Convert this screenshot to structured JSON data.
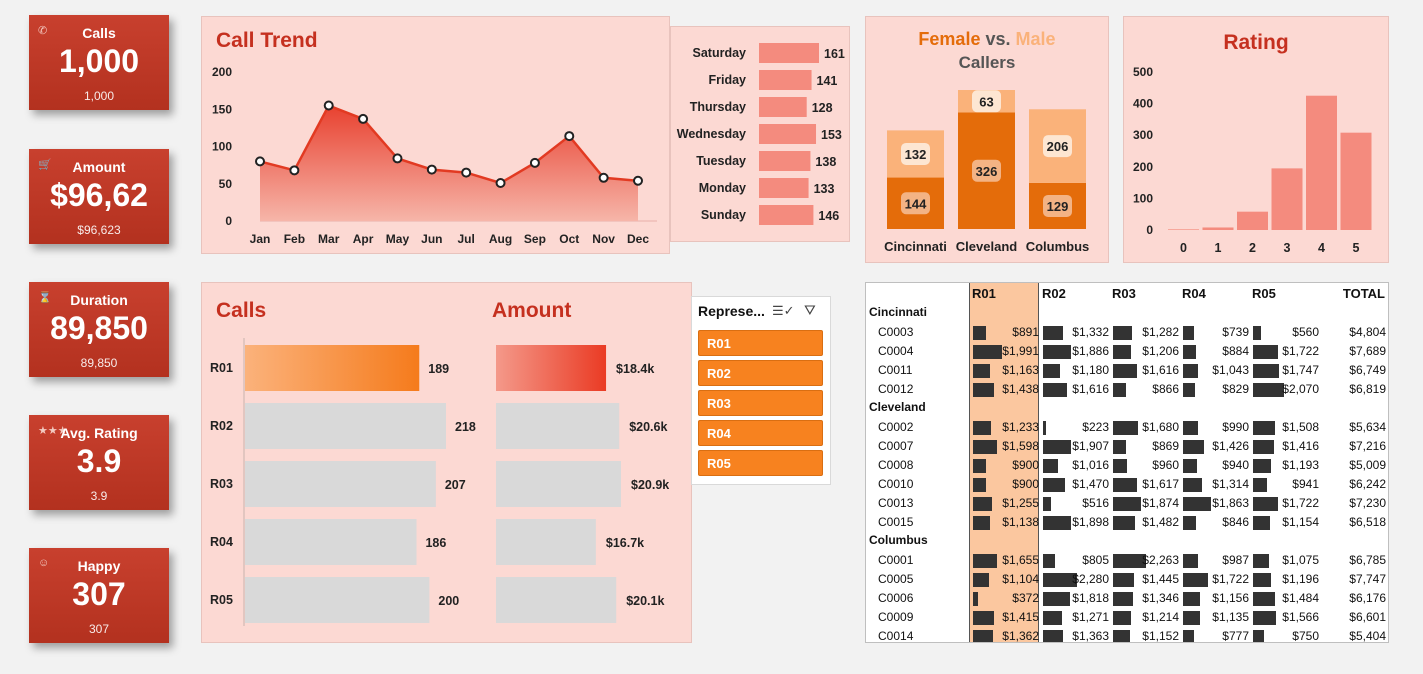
{
  "kpis": [
    {
      "icon": "phone-icon",
      "glyph": "✆",
      "title": "Calls",
      "value": "1,000",
      "sub": "1,000"
    },
    {
      "icon": "cart-icon",
      "glyph": "🛒",
      "title": "Amount",
      "value": "$96,62",
      "sub": "$96,623"
    },
    {
      "icon": "hourglass-icon",
      "glyph": "⌛",
      "title": "Duration",
      "value": "89,850",
      "sub": "89,850"
    },
    {
      "icon": "stars-icon",
      "glyph": "★★★",
      "title": "Avg. Rating",
      "value": "3.9",
      "sub": "3.9"
    },
    {
      "icon": "smiley-icon",
      "glyph": "☺",
      "title": "Happy",
      "value": "307",
      "sub": "307"
    }
  ],
  "call_trend": {
    "title": "Call Trend"
  },
  "weekday": {
    "labels": [
      "Saturday",
      "Friday",
      "Thursday",
      "Wednesday",
      "Tuesday",
      "Monday",
      "Sunday"
    ],
    "values": [
      161,
      141,
      128,
      153,
      138,
      133,
      146
    ]
  },
  "gender": {
    "female": "Female",
    "vs": "vs.",
    "male": "Male",
    "callers": "Callers",
    "color_female": "#e46c0a",
    "color_male": "#fab27a"
  },
  "rating": {
    "title": "Rating"
  },
  "reps": {
    "calls_title": "Calls",
    "amount_title": "Amount",
    "names": [
      "R01",
      "R02",
      "R03",
      "R04",
      "R05"
    ],
    "calls": [
      189,
      218,
      207,
      186,
      200
    ],
    "amount_labels": [
      "$18.4k",
      "$20.6k",
      "$20.9k",
      "$16.7k",
      "$20.1k"
    ]
  },
  "slicer": {
    "title": "Represe...",
    "items": [
      "R01",
      "R02",
      "R03",
      "R04",
      "R05"
    ],
    "multi_icon": "multi-select-icon",
    "clear_icon": "clear-filter-icon"
  },
  "pivot": {
    "headers": [
      "R01",
      "R02",
      "R03",
      "R04",
      "R05",
      "TOTAL"
    ],
    "groups": [
      {
        "city": "Cincinnati",
        "rows": [
          {
            "id": "C0003",
            "vals": [
              "$891",
              "$1,332",
              "$1,282",
              "$739",
              "$560",
              "$4,804"
            ]
          },
          {
            "id": "C0004",
            "vals": [
              "$1,991",
              "$1,886",
              "$1,206",
              "$884",
              "$1,722",
              "$7,689"
            ]
          },
          {
            "id": "C0011",
            "vals": [
              "$1,163",
              "$1,180",
              "$1,616",
              "$1,043",
              "$1,747",
              "$6,749"
            ]
          },
          {
            "id": "C0012",
            "vals": [
              "$1,438",
              "$1,616",
              "$866",
              "$829",
              "$2,070",
              "$6,819"
            ]
          }
        ]
      },
      {
        "city": "Cleveland",
        "rows": [
          {
            "id": "C0002",
            "vals": [
              "$1,233",
              "$223",
              "$1,680",
              "$990",
              "$1,508",
              "$5,634"
            ]
          },
          {
            "id": "C0007",
            "vals": [
              "$1,598",
              "$1,907",
              "$869",
              "$1,426",
              "$1,416",
              "$7,216"
            ]
          },
          {
            "id": "C0008",
            "vals": [
              "$900",
              "$1,016",
              "$960",
              "$940",
              "$1,193",
              "$5,009"
            ]
          },
          {
            "id": "C0010",
            "vals": [
              "$900",
              "$1,470",
              "$1,617",
              "$1,314",
              "$941",
              "$6,242"
            ]
          },
          {
            "id": "C0013",
            "vals": [
              "$1,255",
              "$516",
              "$1,874",
              "$1,863",
              "$1,722",
              "$7,230"
            ]
          },
          {
            "id": "C0015",
            "vals": [
              "$1,138",
              "$1,898",
              "$1,482",
              "$846",
              "$1,154",
              "$6,518"
            ]
          }
        ]
      },
      {
        "city": "Columbus",
        "rows": [
          {
            "id": "C0001",
            "vals": [
              "$1,655",
              "$805",
              "$2,263",
              "$987",
              "$1,075",
              "$6,785"
            ]
          },
          {
            "id": "C0005",
            "vals": [
              "$1,104",
              "$2,280",
              "$1,445",
              "$1,722",
              "$1,196",
              "$7,747"
            ]
          },
          {
            "id": "C0006",
            "vals": [
              "$372",
              "$1,818",
              "$1,346",
              "$1,156",
              "$1,484",
              "$6,176"
            ]
          },
          {
            "id": "C0009",
            "vals": [
              "$1,415",
              "$1,271",
              "$1,214",
              "$1,135",
              "$1,566",
              "$6,601"
            ]
          },
          {
            "id": "C0014",
            "vals": [
              "$1,362",
              "$1,363",
              "$1,152",
              "$777",
              "$750",
              "$5,404"
            ]
          }
        ]
      }
    ]
  },
  "chart_data": [
    {
      "type": "area",
      "title": "Call Trend",
      "categories": [
        "Jan",
        "Feb",
        "Mar",
        "Apr",
        "May",
        "Jun",
        "Jul",
        "Aug",
        "Sep",
        "Oct",
        "Nov",
        "Dec"
      ],
      "values": [
        80,
        68,
        155,
        137,
        84,
        69,
        65,
        51,
        78,
        114,
        58,
        54
      ],
      "ylim": [
        0,
        200
      ],
      "yticks": [
        "0",
        "50",
        "100",
        "150",
        "200"
      ]
    },
    {
      "type": "bar",
      "categories": [
        "Saturday",
        "Friday",
        "Thursday",
        "Wednesday",
        "Tuesday",
        "Monday",
        "Sunday"
      ],
      "values": [
        161,
        141,
        128,
        153,
        138,
        133,
        146
      ]
    },
    {
      "type": "bar",
      "title": "Female vs. Male Callers",
      "categories": [
        "Cincinnati",
        "Cleveland",
        "Columbus"
      ],
      "series": [
        {
          "name": "Female",
          "values": [
            144,
            326,
            129
          ]
        },
        {
          "name": "Male",
          "values": [
            132,
            63,
            206
          ]
        }
      ]
    },
    {
      "type": "bar",
      "title": "Rating",
      "categories": [
        "0",
        "1",
        "2",
        "3",
        "4",
        "5"
      ],
      "values": [
        2,
        8,
        58,
        195,
        425,
        308
      ],
      "ylim": [
        0,
        500
      ],
      "yticks": [
        "0",
        "100",
        "200",
        "300",
        "400",
        "500"
      ]
    },
    {
      "type": "bar",
      "title": "Calls",
      "categories": [
        "R01",
        "R02",
        "R03",
        "R04",
        "R05"
      ],
      "values": [
        189,
        218,
        207,
        186,
        200
      ]
    },
    {
      "type": "bar",
      "title": "Amount",
      "categories": [
        "R01",
        "R02",
        "R03",
        "R04",
        "R05"
      ],
      "values": [
        18.4,
        20.6,
        20.9,
        16.7,
        20.1
      ],
      "labels": [
        "$18.4k",
        "$20.6k",
        "$20.9k",
        "$16.7k",
        "$20.1k"
      ]
    }
  ]
}
